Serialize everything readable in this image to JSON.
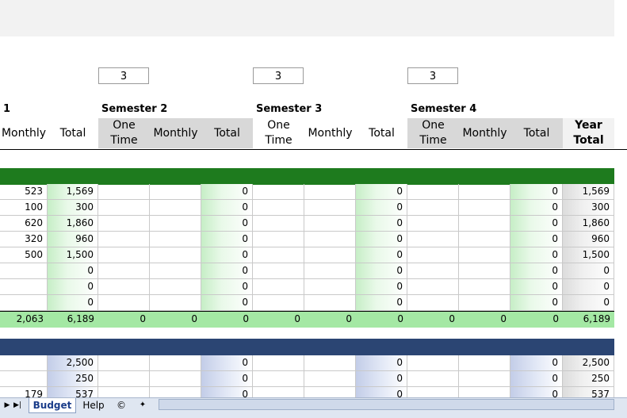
{
  "semester_inputs": [
    "3",
    "3",
    "3"
  ],
  "semester_labels": [
    "1",
    "Semester 2",
    "Semester 3",
    "Semester 4"
  ],
  "headers": {
    "one_time": "One Time",
    "monthly": "Monthly",
    "total": "Total",
    "year_total": "Year Total"
  },
  "colors": {
    "income_band": "#1e7b1e",
    "expense_band": "#2b4573",
    "sum_row": "#a4e8a4"
  },
  "income_rows": [
    [
      "523",
      "1,569",
      "",
      "",
      "0",
      "",
      "",
      "0",
      "",
      "",
      "0",
      "1,569"
    ],
    [
      "100",
      "300",
      "",
      "",
      "0",
      "",
      "",
      "0",
      "",
      "",
      "0",
      "300"
    ],
    [
      "620",
      "1,860",
      "",
      "",
      "0",
      "",
      "",
      "0",
      "",
      "",
      "0",
      "1,860"
    ],
    [
      "320",
      "960",
      "",
      "",
      "0",
      "",
      "",
      "0",
      "",
      "",
      "0",
      "960"
    ],
    [
      "500",
      "1,500",
      "",
      "",
      "0",
      "",
      "",
      "0",
      "",
      "",
      "0",
      "1,500"
    ],
    [
      "",
      "0",
      "",
      "",
      "0",
      "",
      "",
      "0",
      "",
      "",
      "0",
      "0"
    ],
    [
      "",
      "0",
      "",
      "",
      "0",
      "",
      "",
      "0",
      "",
      "",
      "0",
      "0"
    ],
    [
      "",
      "0",
      "",
      "",
      "0",
      "",
      "",
      "0",
      "",
      "",
      "0",
      "0"
    ]
  ],
  "income_sum": [
    "2,063",
    "6,189",
    "0",
    "0",
    "0",
    "0",
    "0",
    "0",
    "0",
    "0",
    "0",
    "6,189"
  ],
  "expense_rows": [
    [
      "",
      "2,500",
      "",
      "",
      "0",
      "",
      "",
      "0",
      "",
      "",
      "0",
      "2,500"
    ],
    [
      "",
      "250",
      "",
      "",
      "0",
      "",
      "",
      "0",
      "",
      "",
      "0",
      "250"
    ],
    [
      "179",
      "537",
      "",
      "",
      "0",
      "",
      "",
      "0",
      "",
      "",
      "0",
      "537"
    ]
  ],
  "sheet_tabs": [
    "Budget",
    "Help",
    "©"
  ]
}
